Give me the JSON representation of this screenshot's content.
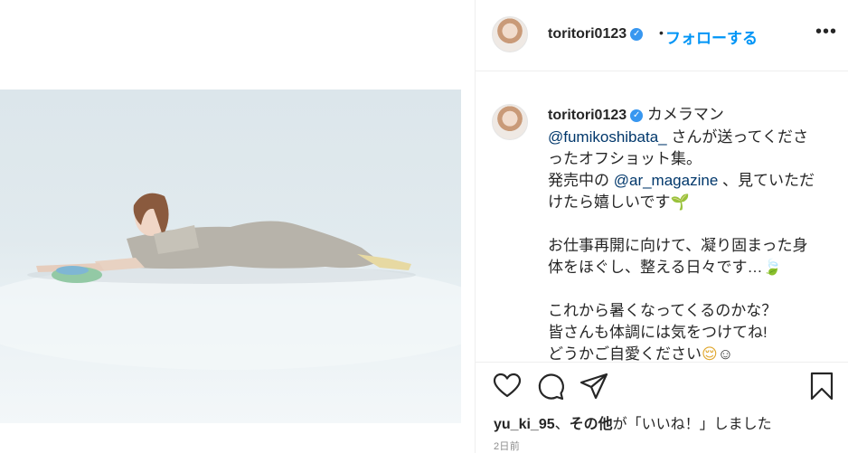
{
  "post": {
    "username": "toritori0123",
    "verified_mark": "✓",
    "follow_label": "フォローする",
    "separator": "•",
    "more_label": "•••"
  },
  "caption": {
    "username": "toritori0123",
    "lines": [
      {
        "parts": [
          {
            "t": "カメラマン"
          }
        ]
      },
      {
        "parts": [
          {
            "t": "@fumikoshibata_",
            "m": true
          },
          {
            "t": " さんが送ってくださ"
          }
        ]
      },
      {
        "parts": [
          {
            "t": "ったオフショット集。"
          }
        ]
      },
      {
        "parts": [
          {
            "t": "発売中の "
          },
          {
            "t": "@ar_magazine",
            "m": true
          },
          {
            "t": " 、見ていただ"
          }
        ]
      },
      {
        "parts": [
          {
            "t": "けたら嬉しいです"
          },
          {
            "t": "🌱",
            "e": "leaf"
          }
        ]
      },
      {
        "parts": [
          {
            "t": " "
          }
        ]
      },
      {
        "parts": [
          {
            "t": "お仕事再開に向けて、凝り固まった身"
          }
        ]
      },
      {
        "parts": [
          {
            "t": "体をほぐし、整える日々です…"
          },
          {
            "t": "🍃",
            "e": "leaf"
          }
        ]
      },
      {
        "parts": [
          {
            "t": " "
          }
        ]
      },
      {
        "parts": [
          {
            "t": "これから暑くなってくるのかな？"
          }
        ]
      },
      {
        "parts": [
          {
            "t": "皆さんも体調には気をつけてね!"
          }
        ]
      },
      {
        "parts": [
          {
            "t": "どうかご自愛ください"
          },
          {
            "t": "😌",
            "e": "face"
          },
          {
            "t": "☺"
          }
        ]
      }
    ]
  },
  "actions": {
    "icons": [
      "heart-icon",
      "comment-icon",
      "share-icon",
      "bookmark-icon"
    ]
  },
  "likes": {
    "user": "yu_ki_95",
    "separator": "、",
    "others": "その他",
    "suffix": "が「いいね！」しました"
  },
  "timestamp": "2日前",
  "colors": {
    "accent": "#0095f6",
    "mention": "#00376b",
    "verified": "#3897f0",
    "muted": "#8e8e8e"
  }
}
